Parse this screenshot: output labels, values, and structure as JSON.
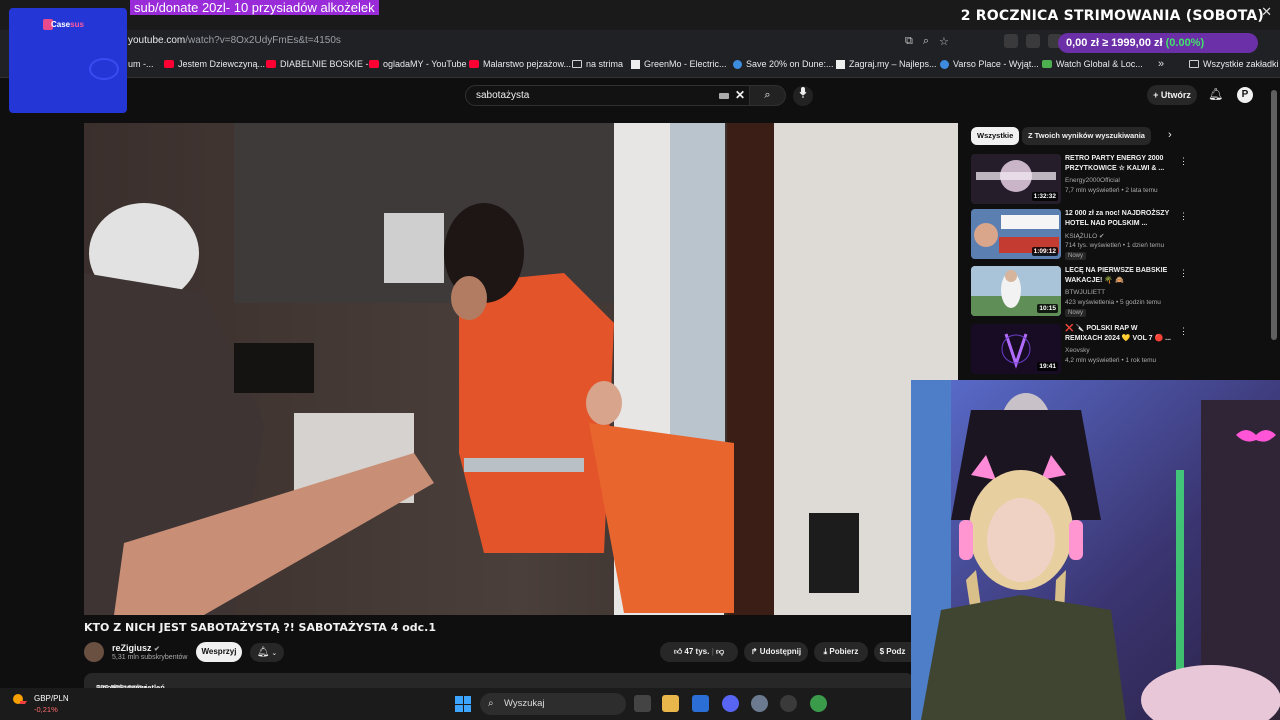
{
  "stream": {
    "donate_text": "sub/donate 20zl- 10 przysiadów alkożelek",
    "anniversary_text": "2 ROCZNICA STRIMOWANIA (SOBOTA)",
    "widget_brand": "Case",
    "widget_brand_accent": "sus",
    "close_glyph": "✕"
  },
  "browser": {
    "url_host": "youtube.com",
    "url_rest": "/watch?v=8Ox2UdyFmEs&t=4150s",
    "crypto_ticker": {
      "values": "0,00 zł ≥ 1999,00 zł",
      "percent": "(0.00%)"
    },
    "bookmarks": [
      {
        "label": "um -...",
        "icon": "youtube-icon"
      },
      {
        "label": "Jestem Dziewczyną...",
        "icon": "youtube-icon"
      },
      {
        "label": "DIABELNIE BOSKIE -...",
        "icon": "youtube-icon"
      },
      {
        "label": "ogladaMY - YouTube",
        "icon": "youtube-icon"
      },
      {
        "label": "Malarstwo pejzażow...",
        "icon": "youtube-icon"
      },
      {
        "label": "na strima",
        "icon": "folder-icon"
      },
      {
        "label": "GreenMo - Electric...",
        "icon": "page-icon"
      },
      {
        "label": "Save 20% on Dune:...",
        "icon": "blue-icon"
      },
      {
        "label": "Zagraj.my – Najleps...",
        "icon": "page-icon"
      },
      {
        "label": "Varso Place - Wyjąt...",
        "icon": "blue-icon"
      },
      {
        "label": "Watch Global & Loc...",
        "icon": "green-icon"
      }
    ],
    "bookmarks_more": "»",
    "all_bookmarks": "Wszystkie zakładki"
  },
  "youtube": {
    "search_value": "sabotażysta",
    "create_label": "Utwórz",
    "avatar_letter": "P",
    "video": {
      "title": "KTO Z NICH JEST SABOTAŻYSTĄ ?! SABOTAŻYSTA 4 odc.1",
      "channel": "reZigiusz",
      "verified": "✔",
      "subscribers": "5,31 mln subskrybentów",
      "support_label": "Wesprzyj",
      "likes": "47 tys.",
      "share_label": "Udostępnij",
      "download_label": "Pobierz",
      "thanks_label": "Podz",
      "views": "306 566 wyświetleń",
      "age": "5 godzin temu",
      "location": "KOŁOBRZEG"
    },
    "chips": [
      "Wszystkie",
      "Z Twoich wyników wyszukiwania"
    ],
    "recommendations": [
      {
        "title": "RETRO PARTY ENERGY 2000 PRZYTKOWICE ☆ KALWI & ...",
        "channel": "Energy2000Official",
        "meta": "7,7 mln wyświetleń • 2 lata temu",
        "duration": "1:32:32",
        "badge": "",
        "thumb_text": "ENERGY 2000",
        "thumb_color": "#2a2230"
      },
      {
        "title": "12 000 zł za noc! NAJDROŻSZY HOTEL NAD POLSKIM ...",
        "channel": "KSIĄŻULO ✔",
        "meta": "714 tys. wyświetleń • 1 dzień temu",
        "duration": "1:09:12",
        "badge": "Nowy",
        "thumb_text": "12000zł",
        "thumb_color": "#4a6da0"
      },
      {
        "title": "LECĘ NA PIERWSZE BABSKIE WAKACJE! 🌴 🙈",
        "channel": "BTWJULIETT",
        "meta": "423 wyświetlenia • 5 godzin temu",
        "duration": "10:15",
        "badge": "Nowy",
        "thumb_text": "",
        "thumb_color": "#7d9ab5"
      },
      {
        "title": "❌ 🔪 POLSKI RAP W REMIXACH 2024 💛 VOL 7 🔴 ...",
        "channel": "Xeovsky",
        "meta": "4,2 mln wyświetleń • 1 rok temu",
        "duration": "19:41",
        "badge": "",
        "thumb_text": "",
        "thumb_color": "#1b0f2a"
      }
    ]
  },
  "taskbar": {
    "fx_pair": "GBP/PLN",
    "fx_change": "-0,21%",
    "search_label": "Wyszukaj"
  },
  "colors": {
    "accent_red": "#ff0033",
    "ticker_bg": "#6b2fa8",
    "donate_bg": "#9a2bd8",
    "widget_bg": "#2536d6"
  }
}
